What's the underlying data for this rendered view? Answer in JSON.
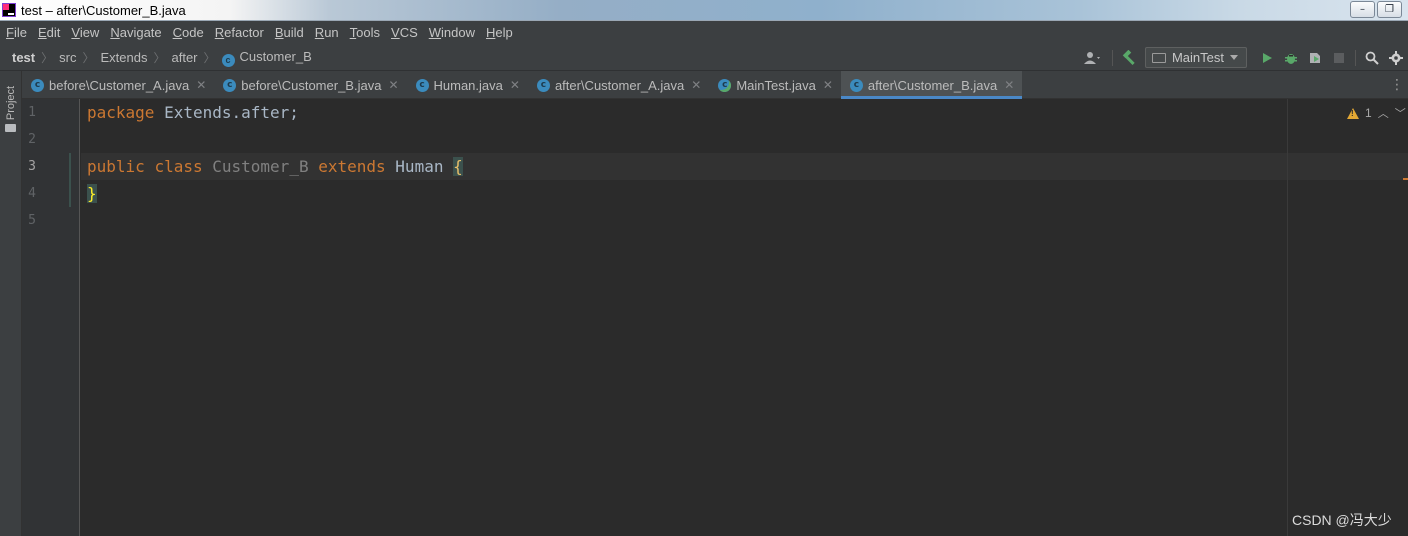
{
  "window": {
    "title": "test – after\\Customer_B.java",
    "buttons": [
      "–",
      "❐",
      "✕"
    ]
  },
  "menu": [
    "File",
    "Edit",
    "View",
    "Navigate",
    "Code",
    "Refactor",
    "Build",
    "Run",
    "Tools",
    "VCS",
    "Window",
    "Help"
  ],
  "breadcrumbs": [
    "test",
    "src",
    "Extends",
    "after",
    "Customer_B"
  ],
  "toolbar": {
    "run_config": "MainTest"
  },
  "side_panel": {
    "project_label": "Project"
  },
  "tabs": [
    {
      "label": "before\\Customer_A.java",
      "active": false
    },
    {
      "label": "before\\Customer_B.java",
      "active": false
    },
    {
      "label": "Human.java",
      "active": false
    },
    {
      "label": "after\\Customer_A.java",
      "active": false
    },
    {
      "label": "MainTest.java",
      "active": false
    },
    {
      "label": "after\\Customer_B.java",
      "active": true
    }
  ],
  "editor": {
    "line_numbers": [
      "1",
      "2",
      "3",
      "4",
      "5"
    ],
    "current_line": 3,
    "code": {
      "l1_kw": "package",
      "l1_rest": " Extends.after;",
      "l3_kw1": "public",
      "l3_kw2": "class",
      "l3_class": "Customer_B",
      "l3_kw3": "extends",
      "l3_super": "Human",
      "l3_brace": "{",
      "l4_brace": "}"
    },
    "warnings_count": "1"
  },
  "watermark": "CSDN @冯大少",
  "colors": {
    "keyword": "#cc7832",
    "text": "#a9b7c6",
    "unused_class": "#808080",
    "brace_match": "#3b514d",
    "tab_underline": "#4a88c7",
    "run": "#59a869"
  }
}
